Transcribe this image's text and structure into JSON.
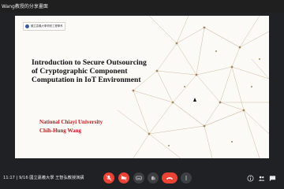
{
  "window": {
    "meeting_title": "Wang教授的分享畫面"
  },
  "slide": {
    "header_text": "國立嘉義大學資訊工程學系",
    "title": "Introduction to Secure Outsourcing of Cryptographic Component Computation in IoT Environment",
    "organization": "National Chiayi University",
    "author": "Chih-Hung Wang",
    "accent_color": "#c0171b",
    "network_color": "#c8ae8f"
  },
  "footer": {
    "meeting_info": "11:17  |  9/16 國立嘉義大學 王智弘教授演講"
  },
  "controls": {
    "icons": [
      "mic-off-icon",
      "camera-off-icon",
      "captions-icon",
      "raise-hand-icon",
      "present-icon",
      "more-options-icon",
      "end-call-icon",
      "info-icon",
      "people-icon",
      "chat-icon"
    ]
  }
}
